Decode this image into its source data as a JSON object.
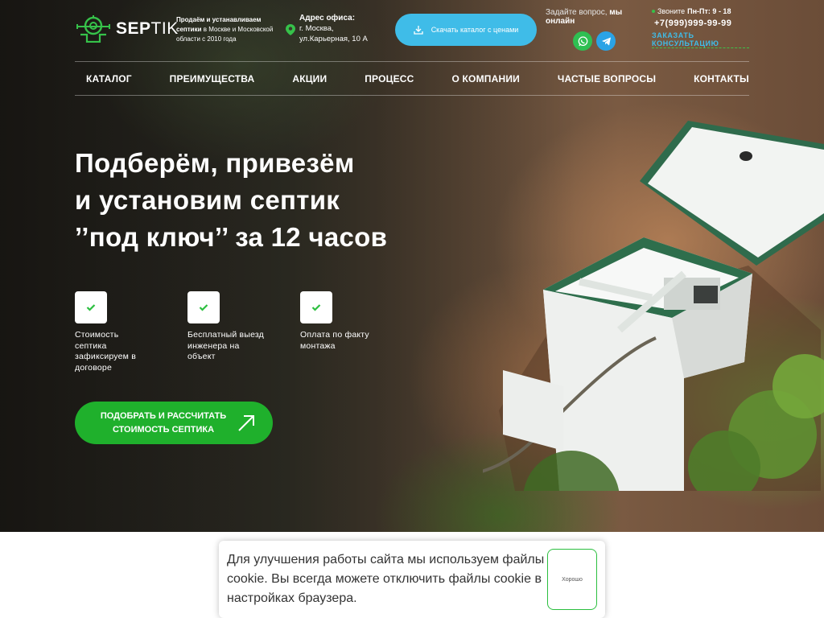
{
  "header": {
    "logo_bold": "SEP",
    "logo_light": "TIK",
    "tagline_bold": "Продаём и устанавливаем септики",
    "tagline_rest": " в Москве и Московской области с 2010 года",
    "address_title": "Адрес офиса:",
    "address_line1": "г. Москва,",
    "address_line2": "ул.Карьерная, 10 А",
    "catalog_button": "Скачать каталог с ценами",
    "ask_prefix": "Задайте вопрос, ",
    "ask_bold": "мы онлайн",
    "hours_prefix": "Звоните",
    "hours_bold": "Пн-Пт: 9 - 18",
    "phone": "+7(999)999-99-99",
    "consult_link": "ЗАКАЗАТЬ КОНСУЛЬТАЦИЮ"
  },
  "nav": {
    "items": [
      "КАТАЛОГ",
      "ПРЕИМУЩЕСТВА",
      "АКЦИИ",
      "ПРОЦЕСС",
      "О КОМПАНИИ",
      "ЧАСТЫЕ ВОПРОСЫ",
      "КОНТАКТЫ"
    ]
  },
  "hero": {
    "headline_lines": [
      "Подберём, привезём",
      "и установим септик",
      "’’под ключ’’ за 12 часов"
    ],
    "features": [
      "Стоимость септика зафиксируем в договоре",
      "Бесплатный выезд инженера на объект",
      "Оплата по факту монтажа"
    ],
    "cta_button": "ПОДОБРАТЬ И РАССЧИТАТЬ СТОИМОСТЬ СЕПТИКА"
  },
  "cookie": {
    "text": "Для улучшения работы сайта мы используем файлы cookie. Вы всегда можете отключить файлы cookie в настройках браузера.",
    "button": "Хорошо"
  },
  "colors": {
    "accent_blue": "#3fbce8",
    "accent_green": "#1fb02c",
    "whatsapp": "#2fbf52",
    "telegram": "#2aa3e6"
  }
}
